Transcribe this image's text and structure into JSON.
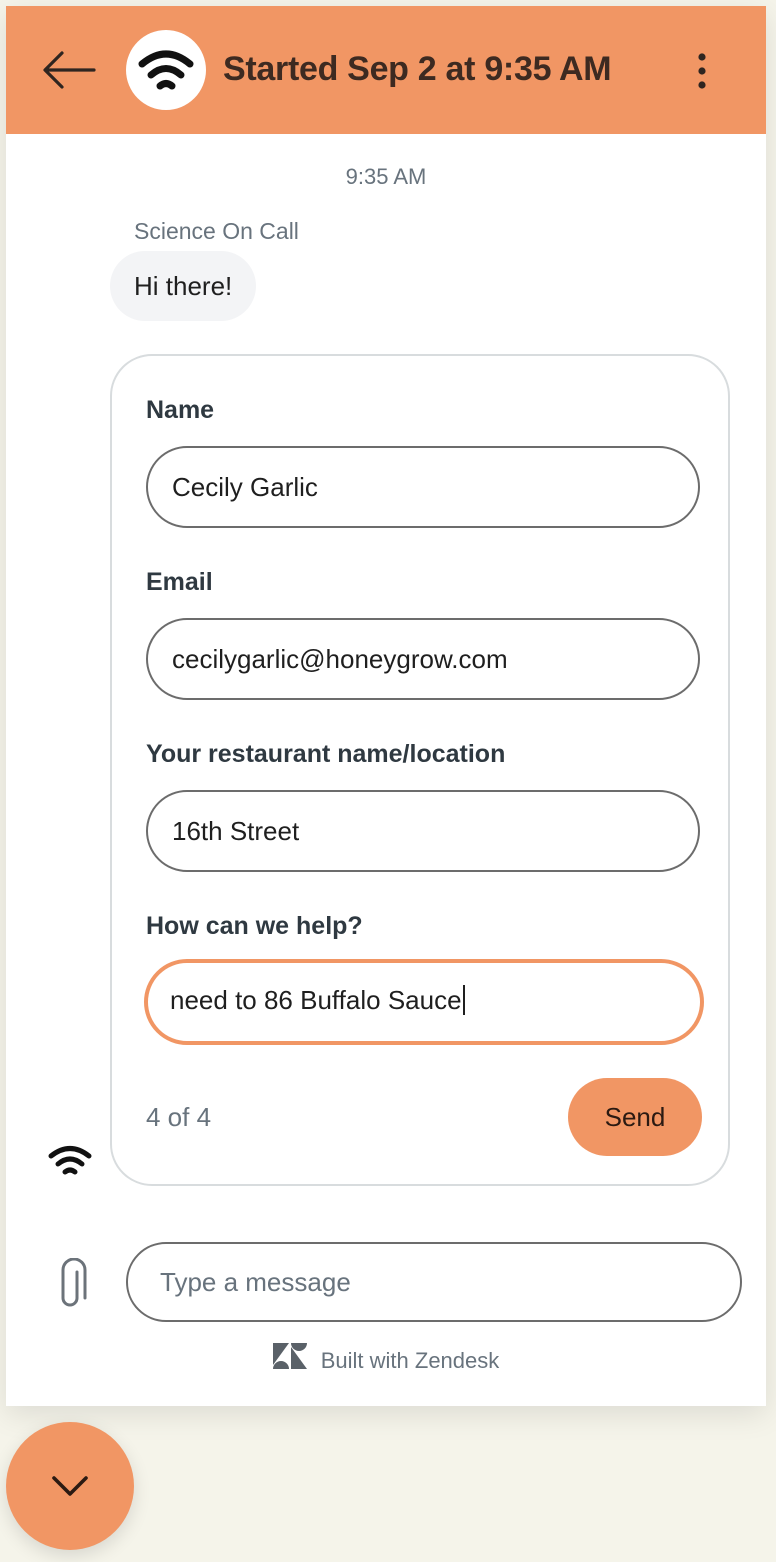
{
  "colors": {
    "accent": "#f19664",
    "header_text": "#3d2a21",
    "muted_text": "#68737d",
    "bubble_bg": "#f3f4f6",
    "page_bg": "#f5f4ea"
  },
  "header": {
    "back_icon": "arrow-left-icon",
    "avatar_icon": "wifi-signal-icon",
    "title": "Started Sep 2 at 9:35 AM",
    "menu_icon": "more-vertical-icon"
  },
  "conversation": {
    "timestamp": "9:35 AM",
    "sender": "Science On Call",
    "message": "Hi there!"
  },
  "form": {
    "fields": [
      {
        "label": "Name",
        "value": "Cecily Garlic"
      },
      {
        "label": "Email",
        "value": "cecilygarlic@honeygrow.com"
      },
      {
        "label": "Your restaurant name/location",
        "value": "16th Street"
      },
      {
        "label": "How can we help?",
        "value": "need to 86 Buffalo Sauce"
      }
    ],
    "step": "4 of 4",
    "send_label": "Send"
  },
  "composer": {
    "attach_icon": "paperclip-icon",
    "placeholder": "Type a message"
  },
  "footer": {
    "logo_icon": "zendesk-logo-icon",
    "text": "Built with Zendesk"
  },
  "launcher": {
    "icon": "chevron-down-icon"
  }
}
